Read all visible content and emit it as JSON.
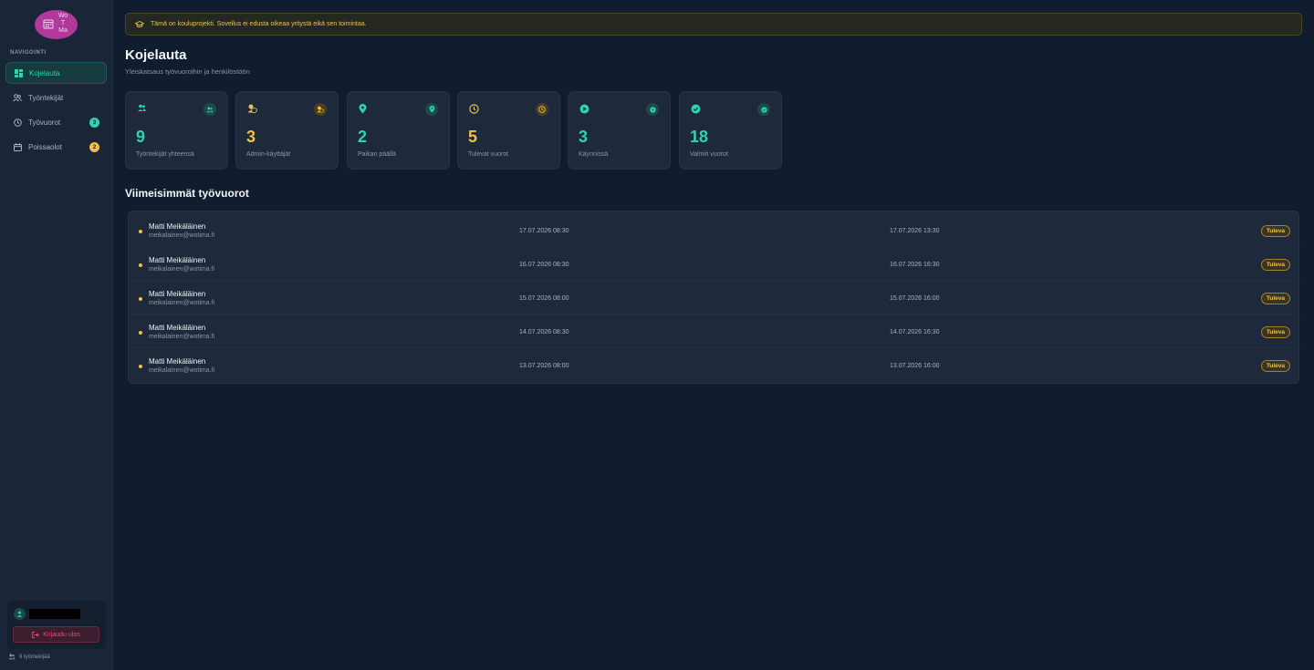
{
  "app": {
    "logo_text": [
      "Wo",
      "T",
      "Ma"
    ]
  },
  "sidebar": {
    "heading": "NAVIGOINTI",
    "items": [
      {
        "label": "Kojelauta",
        "icon": "dashboard-icon",
        "active": true
      },
      {
        "label": "Työntekijät",
        "icon": "users-icon"
      },
      {
        "label": "Työvuorot",
        "icon": "clock-icon",
        "badge": "3",
        "badge_color": "#2dd4b0"
      },
      {
        "label": "Poissaolot",
        "icon": "calendar-icon",
        "badge": "2",
        "badge_color": "#f2c143"
      }
    ],
    "user": {
      "name": "",
      "logout_label": "Kirjaudu ulos"
    },
    "employee_count": "9 työntekijää"
  },
  "notice": {
    "text": "Tämä on kouluprojekti. Sovellus ei edusta oikeaa yritystä eikä sen toimintaa."
  },
  "header": {
    "title": "Kojelauta",
    "subtitle": "Yleiskatsaus työvuoroihin ja henkilöstöön"
  },
  "stats": [
    {
      "value": "9",
      "label": "Työntekijät yhteensä",
      "color": "#2dd4b0",
      "icon": "users-icon"
    },
    {
      "value": "3",
      "label": "Admin-käyttäjät",
      "color": "#f2c143",
      "icon": "shield-user-icon"
    },
    {
      "value": "2",
      "label": "Paikan päällä",
      "color": "#2dd4b0",
      "icon": "map-pin-icon"
    },
    {
      "value": "5",
      "label": "Tulevat vuorot",
      "color": "#f2c143",
      "icon": "clock-icon"
    },
    {
      "value": "3",
      "label": "Käynnissä",
      "color": "#2dd4b0",
      "icon": "play-icon"
    },
    {
      "value": "18",
      "label": "Valmiit vuorot",
      "color": "#2dd4b0",
      "icon": "check-circle-icon"
    }
  ],
  "recent_shifts": {
    "title": "Viimeisimmät työvuorot",
    "rows": [
      {
        "name": "Matti Meikäläinen",
        "email": "meikalainen@wotima.fi",
        "start": "17.07.2026 08:30",
        "end": "17.07.2026 13:30",
        "status": "Tuleva"
      },
      {
        "name": "Matti Meikäläinen",
        "email": "meikalainen@wotima.fi",
        "start": "16.07.2026 08:30",
        "end": "16.07.2026 16:30",
        "status": "Tuleva"
      },
      {
        "name": "Matti Meikäläinen",
        "email": "meikalainen@wotima.fi",
        "start": "15.07.2026 08:00",
        "end": "15.07.2026 16:00",
        "status": "Tuleva"
      },
      {
        "name": "Matti Meikäläinen",
        "email": "meikalainen@wotima.fi",
        "start": "14.07.2026 08:30",
        "end": "14.07.2026 16:30",
        "status": "Tuleva"
      },
      {
        "name": "Matti Meikäläinen",
        "email": "meikalainen@wotima.fi",
        "start": "13.07.2026 08:00",
        "end": "13.07.2026 16:00",
        "status": "Tuleva"
      }
    ]
  }
}
